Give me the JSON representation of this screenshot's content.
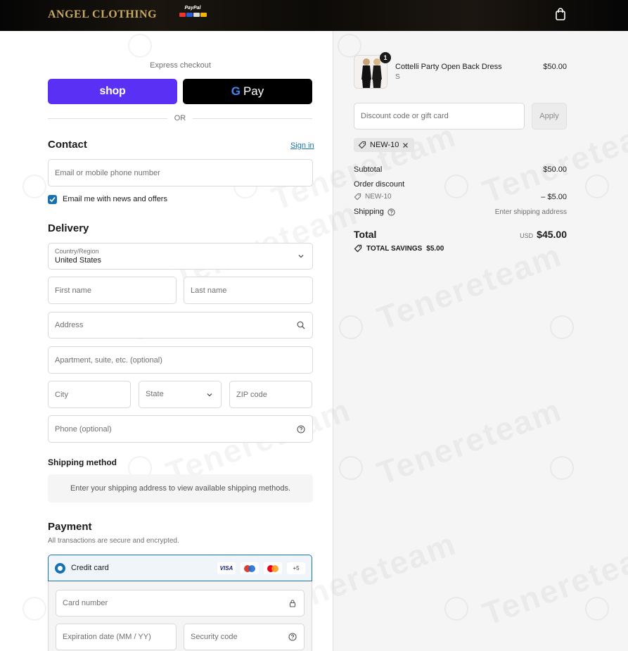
{
  "header": {
    "brand": "ANGEL CLOTHING",
    "paypal_label": "PayPal"
  },
  "watermark_text": "Tenereteam",
  "express": {
    "title": "Express checkout",
    "shop_label": "shop",
    "gpay_g": "G",
    "gpay_label": "Pay",
    "or_label": "OR"
  },
  "contact": {
    "heading": "Contact",
    "sign_in": "Sign in",
    "email_placeholder": "Email or mobile phone number",
    "newsletter_label": "Email me with news and offers",
    "newsletter_checked": true
  },
  "delivery": {
    "heading": "Delivery",
    "country_label": "Country/Region",
    "country_value": "United States",
    "first_name_placeholder": "First name",
    "last_name_placeholder": "Last name",
    "address_placeholder": "Address",
    "apartment_placeholder": "Apartment, suite, etc. (optional)",
    "city_placeholder": "City",
    "state_placeholder": "State",
    "zip_placeholder": "ZIP code",
    "phone_placeholder": "Phone (optional)"
  },
  "shipping_method": {
    "heading": "Shipping method",
    "message": "Enter your shipping address to view available shipping methods."
  },
  "payment": {
    "heading": "Payment",
    "subtitle": "All transactions are secure and encrypted.",
    "credit_card_label": "Credit card",
    "visa_label": "VISA",
    "more_cards": "+5",
    "card_number_placeholder": "Card number",
    "expiration_placeholder": "Expiration date (MM / YY)",
    "security_code_placeholder": "Security code"
  },
  "order": {
    "item": {
      "name": "Cottelli Party Open Back Dress",
      "variant": "S",
      "price": "$50.00",
      "quantity": "1"
    },
    "discount_placeholder": "Discount code or gift card",
    "apply_label": "Apply",
    "applied_code": "NEW-10",
    "subtotal_label": "Subtotal",
    "subtotal_value": "$50.00",
    "order_discount_label": "Order discount",
    "discount_code": "NEW-10",
    "discount_value": "– $5.00",
    "shipping_label": "Shipping",
    "shipping_value": "Enter shipping address",
    "total_label": "Total",
    "currency": "USD",
    "total_value": "$45.00",
    "savings_label": "TOTAL SAVINGS",
    "savings_value": "$5.00"
  },
  "colors": {
    "accent": "#1773b0",
    "shop_pay": "#5a31f4",
    "brand_gold": "#c8a85e"
  }
}
